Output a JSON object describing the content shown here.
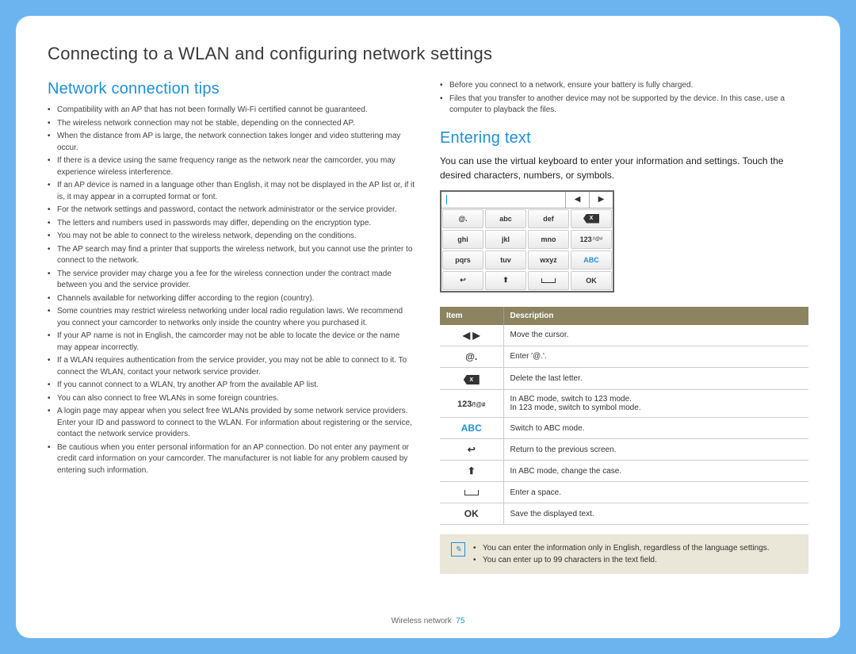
{
  "page": {
    "title": "Connecting to a WLAN and configuring network settings",
    "footer_label": "Wireless network",
    "footer_page": "75"
  },
  "left": {
    "heading": "Network connection tips",
    "tips": [
      "Compatibility with an AP that has not been formally Wi-Fi certified cannot be guaranteed.",
      "The wireless network connection may not be stable, depending on the connected AP.",
      "When the distance from AP is large, the network connection takes longer and video stuttering may occur.",
      "If there is a device using the same frequency range as the network near the camcorder, you may experience wireless interference.",
      "If an AP device is named in a language other than English, it may not be displayed in the AP list or, if it is, it may appear in a corrupted format or font.",
      "For the network settings and password, contact the network administrator or the service provider.",
      "The letters and numbers used in passwords may differ, depending on the encryption type.",
      "You may not be able to connect to the wireless network, depending on the conditions.",
      "The AP search may find a printer that supports the wireless network, but you cannot use the printer to connect to the network.",
      "The service provider may charge you a fee for the wireless connection under the contract made between you and the service provider.",
      "Channels available for networking differ according to the region (country).",
      "Some countries may restrict wireless networking under local radio regulation laws. We recommend you connect your camcorder to networks only inside the country where you purchased it.",
      "If your AP name is not in English, the camcorder may not be able to locate the device or the name may appear incorrectly.",
      "If a WLAN requires authentication from the service provider, you may not be able to connect to it. To connect the WLAN, contact your network service provider.",
      "If you cannot connect to a WLAN, try another AP from the available AP list.",
      "You can also connect to free WLANs in some foreign countries.",
      "A login page may appear when you select free WLANs provided by some network service providers. Enter your ID and password to connect to the WLAN. For information about registering or the service, contact the network service providers.",
      "Be cautious when you enter personal information for an AP connection. Do not enter any payment or credit card information on your camcorder. The manufacturer is not liable for any problem caused by entering such information."
    ]
  },
  "right_top_tips": [
    "Before you connect to a network, ensure your battery is fully charged.",
    "Files that you transfer to another device may not be supported by the device. In this case, use a computer to playback the files."
  ],
  "entering": {
    "heading": "Entering text",
    "intro": "You can use the virtual keyboard to enter your information and settings. Touch the desired characters, numbers, or symbols."
  },
  "keyboard": {
    "rows": [
      [
        "@.",
        "abc",
        "def",
        "⌫"
      ],
      [
        "ghi",
        "jkl",
        "mno",
        "123/!@#"
      ],
      [
        "pqrs",
        "tuv",
        "wxyz",
        "ABC"
      ],
      [
        "↩",
        "⬆",
        "␣",
        "OK"
      ]
    ]
  },
  "table": {
    "header": {
      "item": "Item",
      "desc": "Description"
    },
    "rows": [
      {
        "icon": "◀  ▶",
        "desc": "Move the cursor."
      },
      {
        "icon": "@.",
        "desc": "Enter '@.'."
      },
      {
        "icon": "bksp",
        "desc": "Delete the last letter."
      },
      {
        "icon": "123/!@#",
        "desc": "In ABC mode, switch to 123 mode.\nIn 123 mode, switch to symbol mode."
      },
      {
        "icon": "ABC",
        "desc": "Switch to ABC mode."
      },
      {
        "icon": "↩",
        "desc": "Return to the previous screen."
      },
      {
        "icon": "⬆",
        "desc": "In ABC mode, change the case."
      },
      {
        "icon": "␣",
        "desc": "Enter a space."
      },
      {
        "icon": "OK",
        "desc": "Save the displayed text."
      }
    ]
  },
  "notes": [
    "You can enter the information only in English, regardless of the language settings.",
    "You can enter up to 99 characters in the text field."
  ]
}
